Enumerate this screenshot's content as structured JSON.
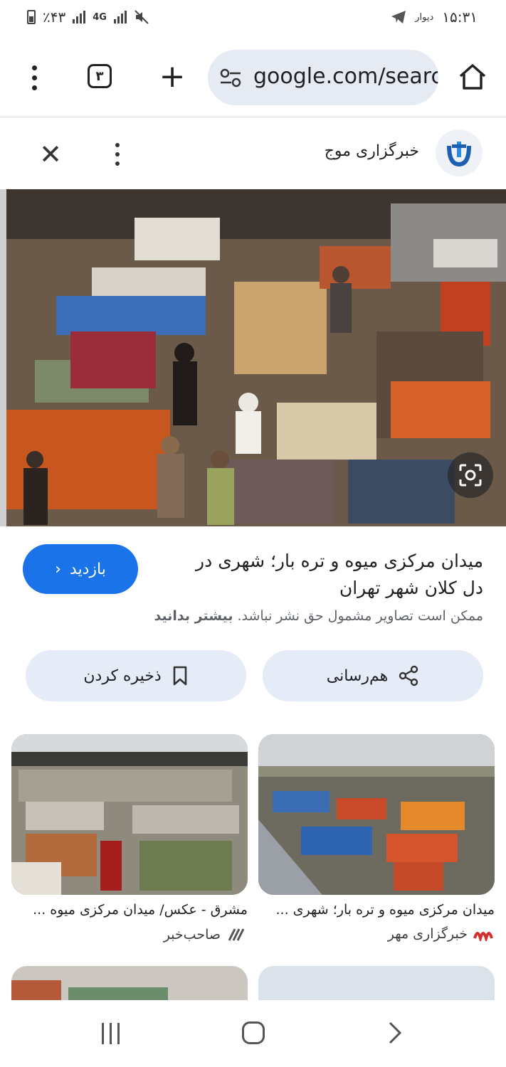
{
  "status_bar": {
    "battery_text": "٪۴۳",
    "network": "4G",
    "carrier": "دیوار",
    "time": "۱۵:۳۱"
  },
  "browser": {
    "tab_count": "۳",
    "url": "google.com/search"
  },
  "result": {
    "source_name": "خبرگزاری موج",
    "title": "میدان مرکزی میوه و تره بار؛ شهری در دل کلان شهر تهران",
    "visit_label": "بازدید",
    "copyright_text": "ممکن است تصاویر مشمول حق نشر نباشد.",
    "learn_more": "بیشتر بدانید",
    "share_label": "هم‌رسانی",
    "save_label": "ذخیره کردن"
  },
  "related": [
    {
      "title": "میدان مرکزی میوه و تره بار؛ شهری ...",
      "source": "خبرگزاری مهر"
    },
    {
      "title": "مشرق - عکس/ میدان مرکزی میوه ...",
      "source": "صاحب‌خبر"
    }
  ],
  "colors": {
    "accent": "#1a73e8",
    "pill_bg": "#e6ecf7",
    "url_bg": "#e6ebf3"
  }
}
